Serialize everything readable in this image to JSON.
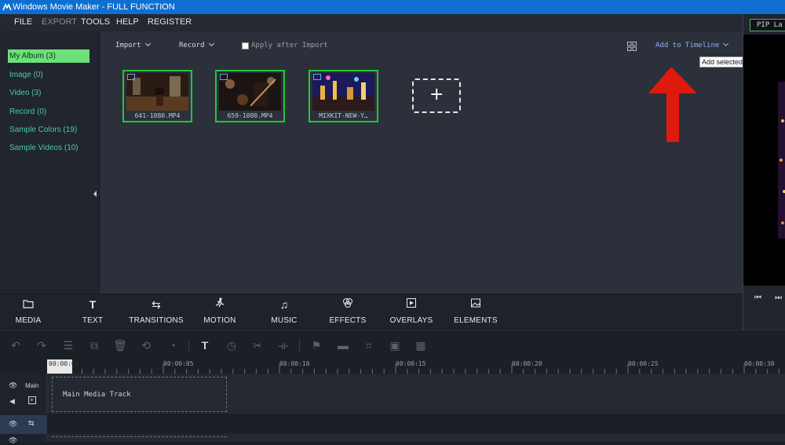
{
  "window": {
    "title": "Windows Movie Maker - FULL FUNCTION"
  },
  "menu": [
    {
      "label": "FILE",
      "enabled": true
    },
    {
      "label": "EXPORT",
      "enabled": false
    },
    {
      "label": "TOOLS",
      "enabled": true
    },
    {
      "label": "HELP",
      "enabled": true
    },
    {
      "label": "REGISTER",
      "enabled": true
    }
  ],
  "sidebar": {
    "items": [
      {
        "label": "My Album (3)",
        "active": true
      },
      {
        "label": "Image (0)"
      },
      {
        "label": "Video (3)"
      },
      {
        "label": "Record (0)"
      },
      {
        "label": "Sample Colors (19)"
      },
      {
        "label": "Sample Videos (10)"
      }
    ]
  },
  "media_toolbar": {
    "import": "Import",
    "record": "Record",
    "apply_after_import": "Apply after Import",
    "apply_checked": false,
    "add_to_timeline": "Add to Timeline",
    "tooltip": "Add selected files to Timeline"
  },
  "media_items": [
    {
      "caption": "641-1080.MP4"
    },
    {
      "caption": "659-1080.MP4"
    },
    {
      "caption": "MIXKIT-NEW-Y…"
    }
  ],
  "preview": {
    "pip_label": "PIP La"
  },
  "tabs": [
    {
      "label": "MEDIA",
      "icon": "folder-icon"
    },
    {
      "label": "TEXT",
      "icon": "text-icon"
    },
    {
      "label": "TRANSITIONS",
      "icon": "transitions-icon"
    },
    {
      "label": "MOTION",
      "icon": "motion-icon"
    },
    {
      "label": "MUSIC",
      "icon": "music-icon"
    },
    {
      "label": "EFFECTS",
      "icon": "effects-icon"
    },
    {
      "label": "OVERLAYS",
      "icon": "overlays-icon"
    },
    {
      "label": "ELEMENTS",
      "icon": "elements-icon"
    }
  ],
  "ruler": {
    "ticks": [
      "00:00:00",
      "00:00:05",
      "00:00:10",
      "00:00:15",
      "00:00:20",
      "00:00:25",
      "00:00:30"
    ]
  },
  "tracks": {
    "main_label": "Main",
    "main_track_placeholder": "Main Media Track"
  },
  "colors": {
    "accent": "#6ee07a",
    "titlebar": "#0f6fd1",
    "arrow": "#e0190f",
    "link": "#8fb3f0"
  }
}
